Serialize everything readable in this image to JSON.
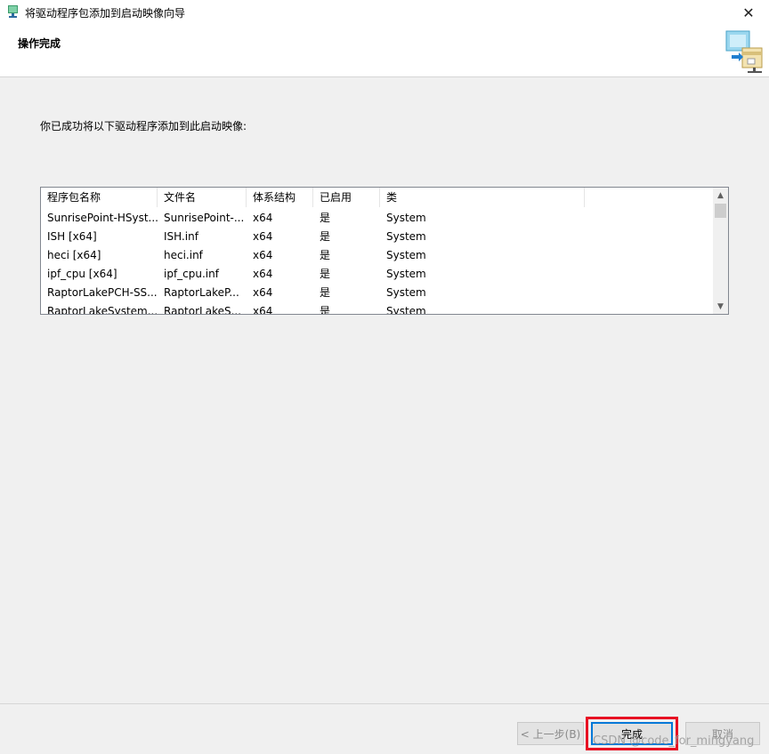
{
  "window": {
    "title": "将驱动程序包添加到启动映像向导",
    "close_glyph": "✕"
  },
  "header": {
    "heading": "操作完成"
  },
  "intro": "你已成功将以下驱动程序添加到此启动映像:",
  "list": {
    "columns": [
      "程序包名称",
      "文件名",
      "体系结构",
      "已启用",
      "类"
    ],
    "rows": [
      [
        "SunrisePoint-HSyst...",
        "SunrisePoint-...",
        "x64",
        "是",
        "System"
      ],
      [
        "ISH [x64]",
        "ISH.inf",
        "x64",
        "是",
        "System"
      ],
      [
        "heci [x64]",
        "heci.inf",
        "x64",
        "是",
        "System"
      ],
      [
        "ipf_cpu [x64]",
        "ipf_cpu.inf",
        "x64",
        "是",
        "System"
      ],
      [
        "RaptorLakePCH-SS...",
        "RaptorLakeP...",
        "x64",
        "是",
        "System"
      ],
      [
        "RaptorLakeSystem...",
        "RaptorLakeS...",
        "x64",
        "是",
        "System"
      ]
    ]
  },
  "buttons": {
    "back": "< 上一步(B)",
    "finish": "完成",
    "cancel": "取消"
  },
  "watermark": "CSDN @code_for_mingyang",
  "colors": {
    "accent": "#0078d7",
    "highlight": "#e81123"
  }
}
